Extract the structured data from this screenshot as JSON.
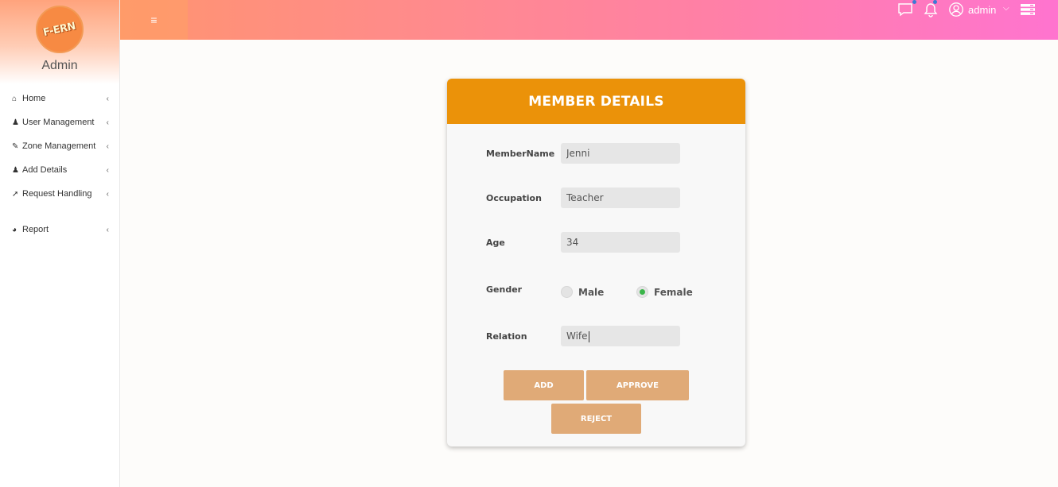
{
  "brand": {
    "logo_text": "F-ERN",
    "role_title": "Admin"
  },
  "sidebar": {
    "items": [
      {
        "label": "Home",
        "icon": "home-icon",
        "glyph": "⌂"
      },
      {
        "label": "User Management",
        "icon": "user-plus-icon",
        "glyph": "👥"
      },
      {
        "label": "Zone Management",
        "icon": "edit-icon",
        "glyph": "✎"
      },
      {
        "label": "Add Details",
        "icon": "user-plus-icon",
        "glyph": "👥"
      },
      {
        "label": "Request Handling",
        "icon": "paper-plane-icon",
        "glyph": "➚"
      },
      {
        "label": "Report",
        "icon": "pie-chart-icon",
        "glyph": "◕"
      }
    ],
    "chevron": "‹"
  },
  "header": {
    "menu_toggle_glyph": "≡",
    "user_name": "admin",
    "user_chevron": "⌵"
  },
  "card": {
    "title": "MEMBER DETAILS",
    "fields": {
      "member_name": {
        "label": "MemberName",
        "value": "Jenni"
      },
      "occupation": {
        "label": "Occupation",
        "value": "Teacher"
      },
      "age": {
        "label": "Age",
        "value": "34"
      },
      "gender": {
        "label": "Gender",
        "options": [
          "Male",
          "Female"
        ],
        "selected": "Female"
      },
      "relation": {
        "label": "Relation",
        "value": "Wife"
      }
    },
    "buttons": {
      "add": "ADD",
      "approve": "APPROVE",
      "reject": "REJECT"
    }
  },
  "colors": {
    "header_gradient": [
      "#ff9470",
      "#ff74cf"
    ],
    "card_header": "#eb9209",
    "button": "#e0aa77",
    "radio_checked": "#3bb54a"
  }
}
